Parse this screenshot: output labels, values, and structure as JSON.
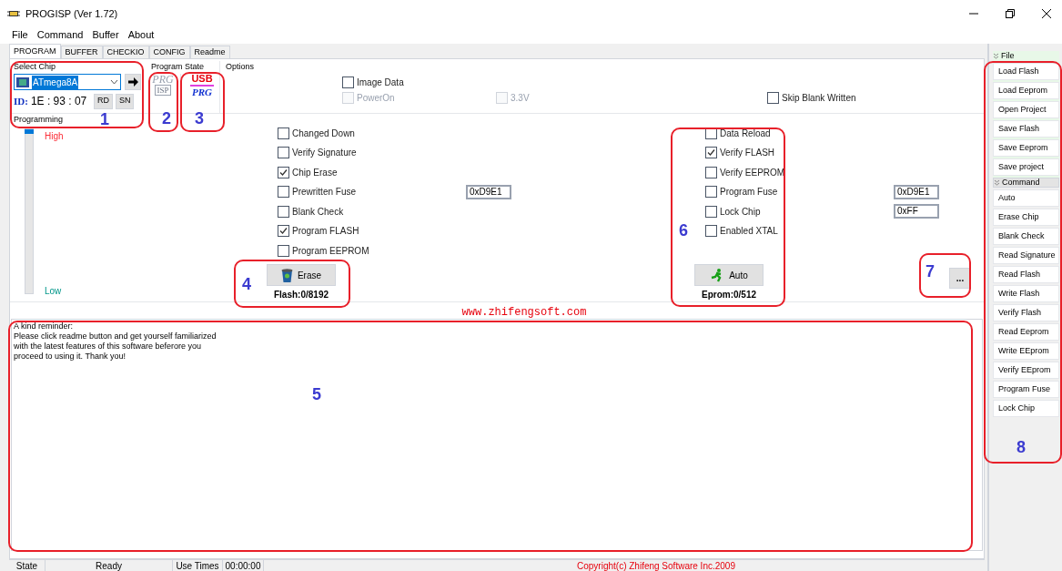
{
  "window": {
    "title": "PROGISP (Ver 1.72)"
  },
  "menu": [
    "File",
    "Command",
    "Buffer",
    "About"
  ],
  "tabs": [
    {
      "label": "PROGRAM",
      "selected": true
    },
    {
      "label": "BUFFER",
      "selected": false
    },
    {
      "label": "CHECKIO",
      "selected": false
    },
    {
      "label": "CONFIG",
      "selected": false
    },
    {
      "label": "Readme",
      "selected": false
    }
  ],
  "select_chip": {
    "title": "Select Chip",
    "chip": "ATmega8A",
    "id_label": "ID:",
    "id_value": "1E : 93 : 07",
    "buttons": [
      "RD",
      "SN"
    ]
  },
  "program_state": {
    "title": "Program State",
    "isp_logo": [
      "PRG",
      "ISP"
    ],
    "usb_logo": [
      "USB",
      "PRG"
    ]
  },
  "options": {
    "title": "Options",
    "items": [
      {
        "label": "Image Data",
        "checked": false,
        "disabled": false
      },
      {
        "label": "PowerOn",
        "checked": false,
        "disabled": true
      },
      {
        "label": "3.3V",
        "checked": false,
        "disabled": true
      },
      {
        "label": "Skip Blank Written",
        "checked": false,
        "disabled": false
      }
    ]
  },
  "programming": {
    "title": "Programming",
    "slider": {
      "level": 1,
      "high": "High",
      "low": "Low"
    },
    "left_options": [
      {
        "label": "Changed Down",
        "checked": false
      },
      {
        "label": "Verify Signature",
        "checked": false
      },
      {
        "label": "Chip Erase",
        "checked": true
      },
      {
        "label": "Prewritten Fuse",
        "checked": false,
        "field": "0xD9E1"
      },
      {
        "label": "Blank Check",
        "checked": false
      },
      {
        "label": "Program FLASH",
        "checked": true
      },
      {
        "label": "Program EEPROM",
        "checked": false
      }
    ],
    "right_options": [
      {
        "label": "Data Reload",
        "checked": false
      },
      {
        "label": "Verify FLASH",
        "checked": true
      },
      {
        "label": "Verify EEPROM",
        "checked": false
      },
      {
        "label": "Program Fuse",
        "checked": false,
        "field": "0xD9E1"
      },
      {
        "label": "Lock Chip",
        "checked": false,
        "field": "0xFF"
      },
      {
        "label": "Enabled XTAL",
        "checked": false
      }
    ],
    "erase_button": "Erase",
    "flash_counter": "Flash:0/8192",
    "auto_button": "Auto",
    "eprom_counter": "Eprom:0/512",
    "more_button": "..."
  },
  "website": "www.zhifengsoft.com",
  "log": [
    "A kind reminder:",
    "Please click readme button and get yourself familiarized",
    "with the latest features of this software beferore you",
    "proceed to using it. Thank you!"
  ],
  "sidebar": {
    "groups": [
      {
        "title": "File",
        "items": [
          "Load Flash",
          "Load Eeprom",
          "Open Project",
          "Save Flash",
          "Save Eeprom",
          "Save project"
        ]
      },
      {
        "title": "Command",
        "items": [
          "Auto",
          "Erase Chip",
          "Blank Check",
          "Read Signature",
          "Read Flash",
          "Write Flash",
          "Verify Flash",
          "Read Eeprom",
          "Write EEprom",
          "Verify EEprom",
          "Program Fuse",
          "Lock Chip"
        ]
      }
    ]
  },
  "status_bar": {
    "state_label": "State",
    "state": "Ready",
    "use_times_label": "Use Times",
    "use_times": "00:00:00",
    "copyright": "Copyright(c) Zhifeng Software Inc.2009"
  },
  "annotations": [
    "1",
    "2",
    "3",
    "4",
    "5",
    "6",
    "7",
    "8"
  ]
}
